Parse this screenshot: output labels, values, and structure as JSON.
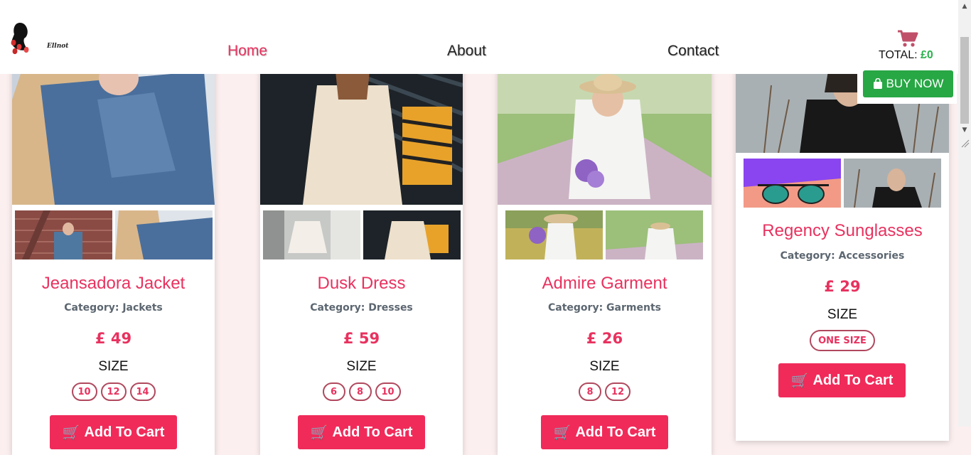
{
  "header": {
    "logo_text": "Ellnot",
    "nav": [
      {
        "label": "Home",
        "active": true
      },
      {
        "label": "About",
        "active": false
      },
      {
        "label": "Contact",
        "active": false
      }
    ],
    "cart": {
      "total_label": "TOTAL:",
      "total_value": "£0"
    },
    "buy_now_label": "BUY NOW"
  },
  "colors": {
    "accent": "#e8325f",
    "button_pink": "#f02b5a",
    "buy_green": "#28a745",
    "page_bg": "#fcefef"
  },
  "products": [
    {
      "name": "Jeansadora Jacket",
      "category": "Category: Jackets",
      "price": "£ 49",
      "size_label": "SIZE",
      "sizes": [
        "10",
        "12",
        "14"
      ],
      "button_label": "Add To Cart"
    },
    {
      "name": "Dusk Dress",
      "category": "Category: Dresses",
      "price": "£ 59",
      "size_label": "SIZE",
      "sizes": [
        "6",
        "8",
        "10"
      ],
      "button_label": "Add To Cart"
    },
    {
      "name": "Admire Garment",
      "category": "Category: Garments",
      "price": "£ 26",
      "size_label": "SIZE",
      "sizes": [
        "8",
        "12"
      ],
      "button_label": "Add To Cart"
    },
    {
      "name": "Regency Sunglasses",
      "category": "Category: Accessories",
      "price": "£ 29",
      "size_label": "SIZE",
      "sizes": [
        "ONE SIZE"
      ],
      "button_label": "Add To Cart"
    }
  ]
}
